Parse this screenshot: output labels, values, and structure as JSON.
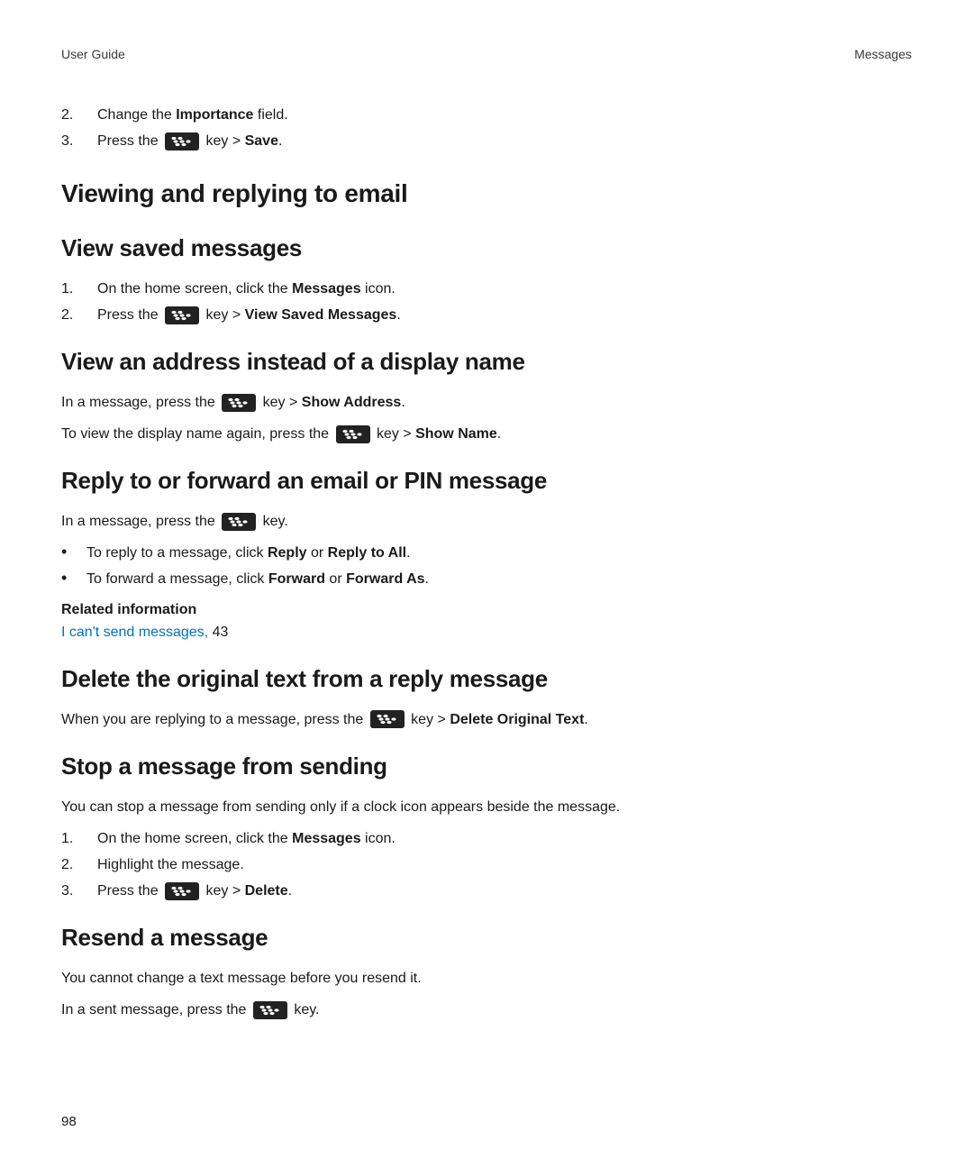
{
  "header": {
    "left": "User Guide",
    "right": "Messages"
  },
  "intro_steps": [
    {
      "n": "2.",
      "parts": [
        "Change the ",
        {
          "b": "Importance"
        },
        " field."
      ]
    },
    {
      "n": "3.",
      "parts": [
        "Press the ",
        {
          "key": true
        },
        " key > ",
        {
          "b": "Save"
        },
        "."
      ]
    }
  ],
  "h1_viewing": "Viewing and replying to email",
  "h2_view_saved": "View saved messages",
  "view_saved_steps": [
    {
      "n": "1.",
      "parts": [
        "On the home screen, click the ",
        {
          "b": "Messages"
        },
        " icon."
      ]
    },
    {
      "n": "2.",
      "parts": [
        "Press the ",
        {
          "key": true
        },
        " key > ",
        {
          "b": "View Saved Messages"
        },
        "."
      ]
    }
  ],
  "h2_view_address": "View an address instead of a display name",
  "view_addr_p1": [
    "In a message, press the ",
    {
      "key": true
    },
    " key > ",
    {
      "b": "Show Address"
    },
    "."
  ],
  "view_addr_p2": [
    "To view the display name again, press the ",
    {
      "key": true
    },
    " key > ",
    {
      "b": "Show Name"
    },
    "."
  ],
  "h2_reply_forward": "Reply to or forward an email or PIN message",
  "reply_forward_p": [
    "In a message, press the ",
    {
      "key": true
    },
    " key."
  ],
  "reply_forward_bullets": [
    [
      "To reply to a message, click ",
      {
        "b": "Reply"
      },
      " or ",
      {
        "b": "Reply to All"
      },
      "."
    ],
    [
      "To forward a message, click ",
      {
        "b": "Forward"
      },
      " or ",
      {
        "b": "Forward As"
      },
      "."
    ]
  ],
  "related": {
    "title": "Related information",
    "link": "I can't send messages,",
    "page_ref": " 43"
  },
  "h2_delete_original": "Delete the original text from a reply message",
  "delete_original_p": [
    "When you are replying to a message, press the ",
    {
      "key": true
    },
    " key > ",
    {
      "b": "Delete Original Text"
    },
    "."
  ],
  "h2_stop_sending": "Stop a message from sending",
  "stop_sending_p": "You can stop a message from sending only if a clock icon appears beside the message.",
  "stop_sending_steps": [
    {
      "n": "1.",
      "parts": [
        "On the home screen, click the ",
        {
          "b": "Messages"
        },
        " icon."
      ]
    },
    {
      "n": "2.",
      "parts": [
        "Highlight the message."
      ]
    },
    {
      "n": "3.",
      "parts": [
        "Press the ",
        {
          "key": true
        },
        " key > ",
        {
          "b": "Delete"
        },
        "."
      ]
    }
  ],
  "h2_resend": "Resend a message",
  "resend_p1": "You cannot change a text message before you resend it.",
  "resend_p2": [
    "In a sent message, press the ",
    {
      "key": true
    },
    " key."
  ],
  "page_number": "98"
}
